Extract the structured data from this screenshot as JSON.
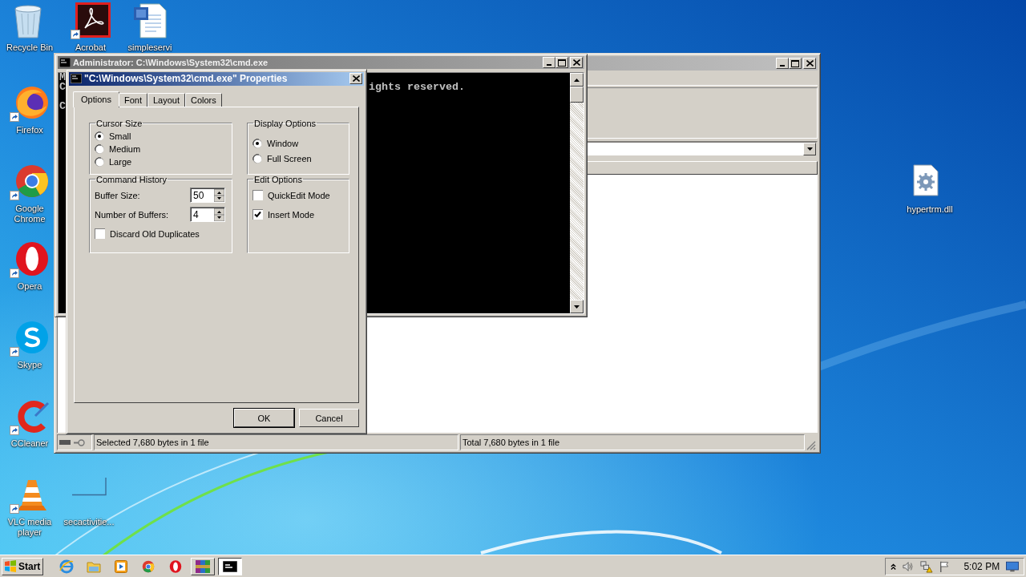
{
  "desktop_icons": [
    {
      "label": "Recycle Bin",
      "kind": "recycle-bin",
      "shortcut": false
    },
    {
      "label": "Acrobat",
      "kind": "acrobat",
      "shortcut": true
    },
    {
      "label": "simpleservi",
      "kind": "word-doc",
      "shortcut": false
    },
    {
      "label": "Firefox",
      "kind": "firefox",
      "shortcut": true
    },
    {
      "label": "Google Chrome",
      "kind": "chrome",
      "shortcut": true
    },
    {
      "label": "Opera",
      "kind": "opera",
      "shortcut": true
    },
    {
      "label": "Skype",
      "kind": "skype",
      "shortcut": true
    },
    {
      "label": "CCleaner",
      "kind": "ccleaner",
      "shortcut": true
    },
    {
      "label": "VLC media player",
      "kind": "vlc",
      "shortcut": true
    },
    {
      "label": "secactivitie...",
      "kind": "blank",
      "shortcut": false
    },
    {
      "label": "hypertrm.dll",
      "kind": "dll",
      "shortcut": false
    }
  ],
  "explorer_window": {
    "status": [
      "Selected 7,680 bytes in 1 file",
      "Total 7,680 bytes in 1 file"
    ]
  },
  "cmd_window": {
    "title": "Administrator: C:\\Windows\\System32\\cmd.exe",
    "active": false,
    "lines": [
      {
        "start": "M"
      },
      {
        "start": "C",
        "end": "ights reserved."
      },
      {
        "start": "C"
      }
    ]
  },
  "dialog": {
    "title": "\"C:\\Windows\\System32\\cmd.exe\" Properties",
    "tabs": [
      {
        "label": "Options",
        "selected": true
      },
      {
        "label": "Font",
        "selected": false
      },
      {
        "label": "Layout",
        "selected": false
      },
      {
        "label": "Colors",
        "selected": false
      }
    ],
    "groups": [
      {
        "title": "Cursor Size",
        "items": [
          {
            "kind": "radio",
            "label": "Small",
            "selected": true
          },
          {
            "kind": "radio",
            "label": "Medium",
            "selected": false
          },
          {
            "kind": "radio",
            "label": "Large",
            "selected": false
          }
        ]
      },
      {
        "title": "Display Options",
        "items": [
          {
            "kind": "radio",
            "label": "Window",
            "selected": true
          },
          {
            "kind": "radio",
            "label": "Full Screen",
            "selected": false
          }
        ]
      },
      {
        "title": "Command History",
        "items": [
          {
            "kind": "spin",
            "label": "Buffer Size:",
            "value": "50"
          },
          {
            "kind": "spin",
            "label": "Number of Buffers:",
            "value": "4"
          },
          {
            "kind": "check",
            "label": "Discard Old Duplicates",
            "checked": false
          }
        ]
      },
      {
        "title": "Edit Options",
        "items": [
          {
            "kind": "check",
            "label": "QuickEdit Mode",
            "checked": false
          },
          {
            "kind": "check",
            "label": "Insert Mode",
            "checked": true
          }
        ]
      }
    ],
    "buttons": [
      {
        "label": "OK",
        "default": true
      },
      {
        "label": "Cancel",
        "default": false
      }
    ]
  },
  "taskbar": {
    "start": "Start",
    "apps": [
      {
        "kind": "ie",
        "running": false,
        "selected": false
      },
      {
        "kind": "explorer",
        "running": false,
        "selected": false
      },
      {
        "kind": "media-player",
        "running": false,
        "selected": false
      },
      {
        "kind": "chrome",
        "running": false,
        "selected": false
      },
      {
        "kind": "opera",
        "running": false,
        "selected": false
      },
      {
        "kind": "winrar",
        "running": true,
        "selected": false
      },
      {
        "kind": "cmd",
        "running": true,
        "selected": true
      }
    ],
    "clock": "5:02 PM"
  }
}
